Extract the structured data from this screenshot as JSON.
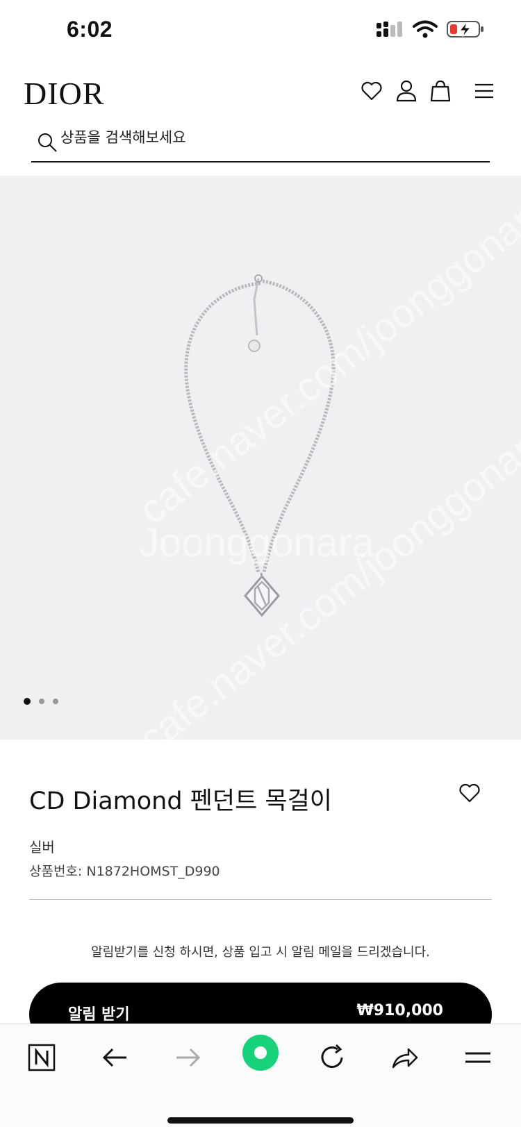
{
  "status_bar": {
    "time": "6:02"
  },
  "header": {
    "logo": "DIOR",
    "icons": [
      "heart-icon",
      "user-icon",
      "shopping-bag-icon",
      "menu-icon"
    ]
  },
  "search": {
    "placeholder": "상품을 검색해보세요"
  },
  "gallery": {
    "watermarks": [
      "cafe.naver.com/joonggonara",
      "Joonggonara",
      "cafe.naver.com/joonggonara"
    ],
    "slides_total": 3,
    "active_slide": 1
  },
  "product": {
    "title": "CD Diamond 펜던트 목걸이",
    "color": "실버",
    "sku": "상품번호: N1872HOMST_D990",
    "notice": "알림받기를 신청 하시면, 상품 입고 시 알림 메일을 드리겠습니다.",
    "notify_label": "알림 받기",
    "price": "₩910,000"
  },
  "browser_bar": {
    "icons": [
      "naver-icon",
      "back-arrow-icon",
      "forward-arrow-icon",
      "green-dot-icon",
      "reload-icon",
      "share-icon",
      "menu-icon"
    ],
    "accent": "#17d27b"
  }
}
